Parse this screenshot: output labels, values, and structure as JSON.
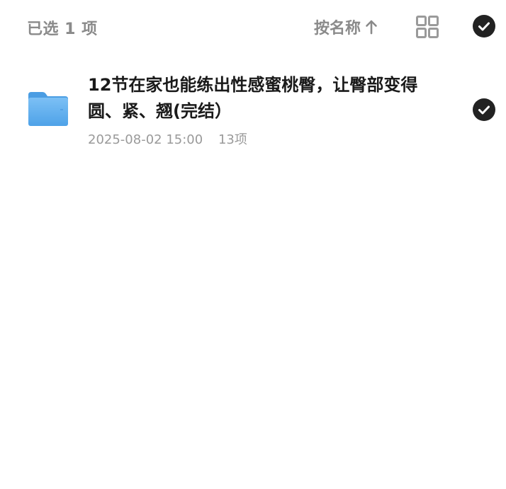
{
  "toolbar": {
    "selected_label": "已选 1 项",
    "sort_label": "按名称",
    "sort_icon": "arrow-up-icon",
    "view_icon": "grid-view-icon",
    "select_all_icon": "check-circle-icon"
  },
  "items": [
    {
      "type": "folder",
      "icon": "folder-icon",
      "title": "12节在家也能练出性感蜜桃臀，让臀部变得圆、紧、翘(完结）",
      "date": "2025-08-02 15:00",
      "count": "13项",
      "selected": true
    }
  ],
  "colors": {
    "text_muted": "#8a8a8a",
    "text_primary": "#1a1a1a",
    "check_bg": "#222222",
    "folder_blue": "#5aaef0"
  }
}
